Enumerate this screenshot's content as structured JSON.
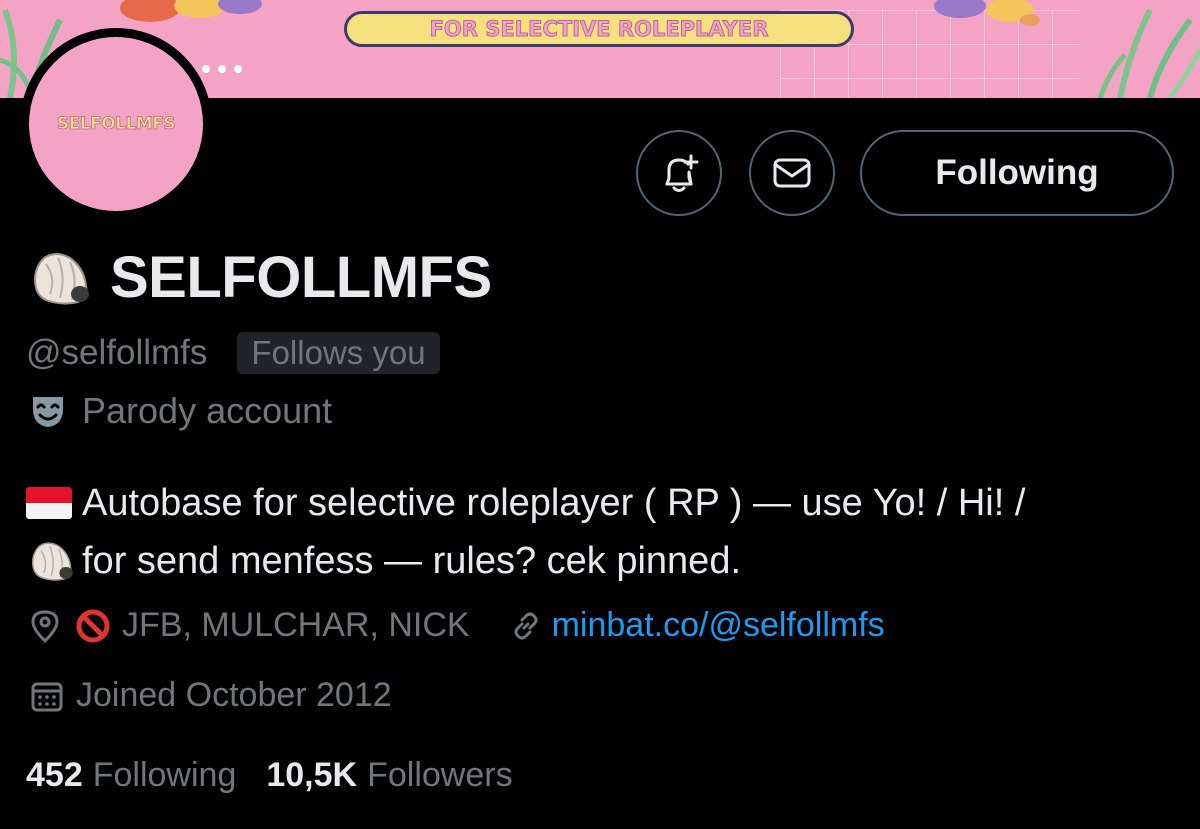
{
  "banner": {
    "tagline": "FOR SELECTIVE ROLEPLAYER",
    "background_color": "#f4a3c4"
  },
  "avatar": {
    "text": "SELFOLLMFS"
  },
  "actions": {
    "notify_icon": "bell-plus-icon",
    "message_icon": "envelope-icon",
    "follow_label": "Following"
  },
  "profile": {
    "name_emoji": "shell-icon",
    "display_name": "SELFOLLMFS",
    "handle": "@selfollmfs",
    "follows_you": "Follows you",
    "parody_label": "Parody account"
  },
  "bio": {
    "line1": "Autobase for selective roleplayer ( RP ) — use Yo! / Hi! /",
    "line2": "for send menfess — rules? cek pinned."
  },
  "meta": {
    "location": "JFB, MULCHAR, NICK",
    "website": "minbat.co/@selfollmfs",
    "joined": "Joined October 2012"
  },
  "stats": {
    "following_count": "452",
    "following_label": "Following",
    "followers_count": "10,5K",
    "followers_label": "Followers"
  },
  "colors": {
    "background": "#000000",
    "text_primary": "#e7e9ea",
    "text_secondary": "#71767b",
    "link": "#1d9bf0",
    "border": "#536471"
  }
}
